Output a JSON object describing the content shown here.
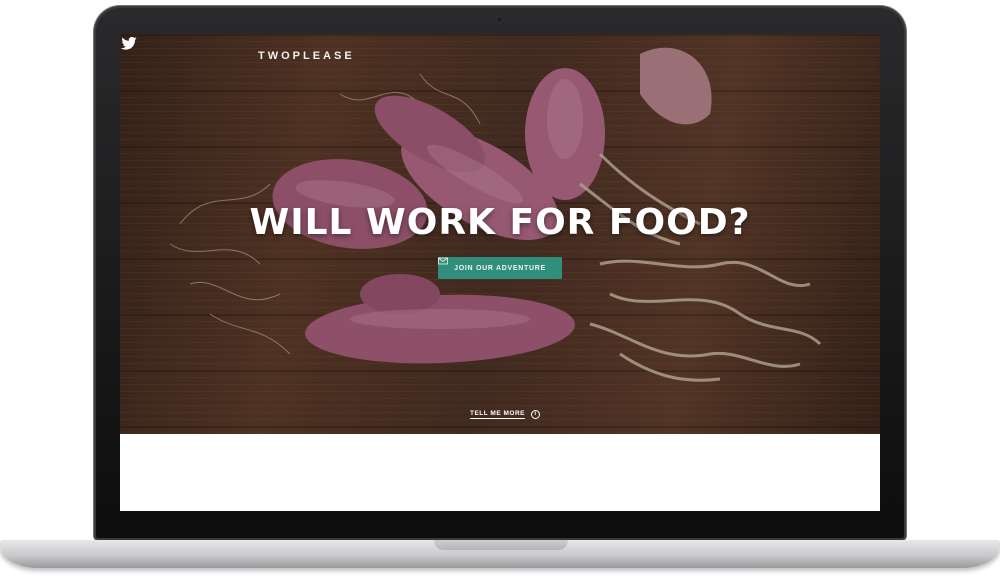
{
  "site": {
    "brand": "TWOPLEASE",
    "headline": "WILL WORK FOR FOOD?",
    "cta_label": "JOIN OUR ADVENTURE",
    "more_label": "TELL ME MORE",
    "info_glyph": "i"
  },
  "icons": {
    "social": "twitter-icon",
    "cta": "mail-icon",
    "more": "info-icon"
  },
  "colors": {
    "accent": "#2f8f7c",
    "wood": "#4a3024",
    "shallot": "#b06a86"
  }
}
